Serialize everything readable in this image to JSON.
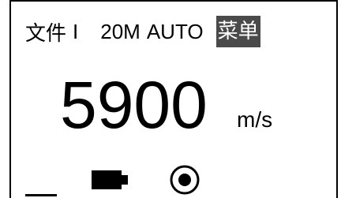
{
  "status_bar": {
    "file_label": "文件",
    "file_index": "I",
    "frequency": "20M",
    "mode": "AUTO",
    "menu_label": "菜单"
  },
  "measurement": {
    "value": "5900",
    "unit": "m/s"
  },
  "indicators": {
    "cursor_icon": "underscore-cursor",
    "battery_icon": "battery-full",
    "target_icon": "target-dot"
  },
  "colors": {
    "menu_highlight": "#4a4a4a",
    "foreground": "#000000",
    "background": "#ffffff"
  }
}
